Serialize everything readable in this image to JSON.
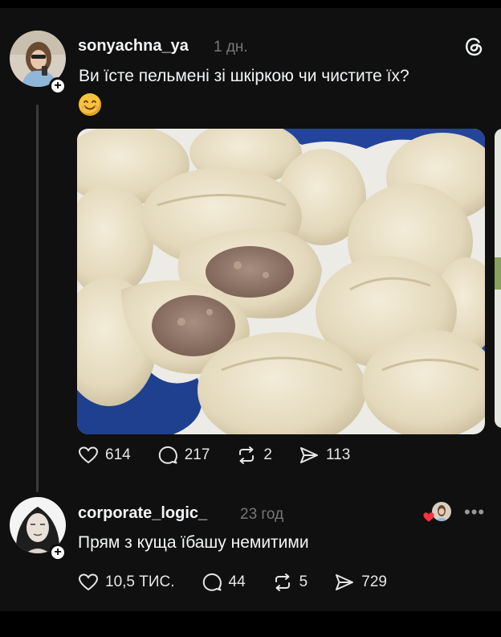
{
  "post": {
    "username": "sonyachna_ya",
    "time": "1 дн.",
    "text": "Ви їсте пельмені зі шкіркою чи чистите їх?",
    "emoji": "smiling-face-emoji",
    "stats": {
      "likes": "614",
      "comments": "217",
      "reposts": "2",
      "shares": "113"
    }
  },
  "reply": {
    "username": "corporate_logic_",
    "time": "23 год",
    "text": "Прям з куща їбашу немитими",
    "stats": {
      "likes": "10,5 ТИС.",
      "comments": "44",
      "reposts": "5",
      "shares": "729"
    }
  },
  "icons": {
    "app": "threads-logo-icon",
    "like": "heart-icon",
    "comment": "comment-bubble-icon",
    "repost": "repost-icon",
    "share": "send-icon",
    "more": "more-dots-icon"
  },
  "colors": {
    "background": "#101010",
    "text": "#f3f5f7",
    "muted": "#777777",
    "liked": "#ff3040"
  }
}
